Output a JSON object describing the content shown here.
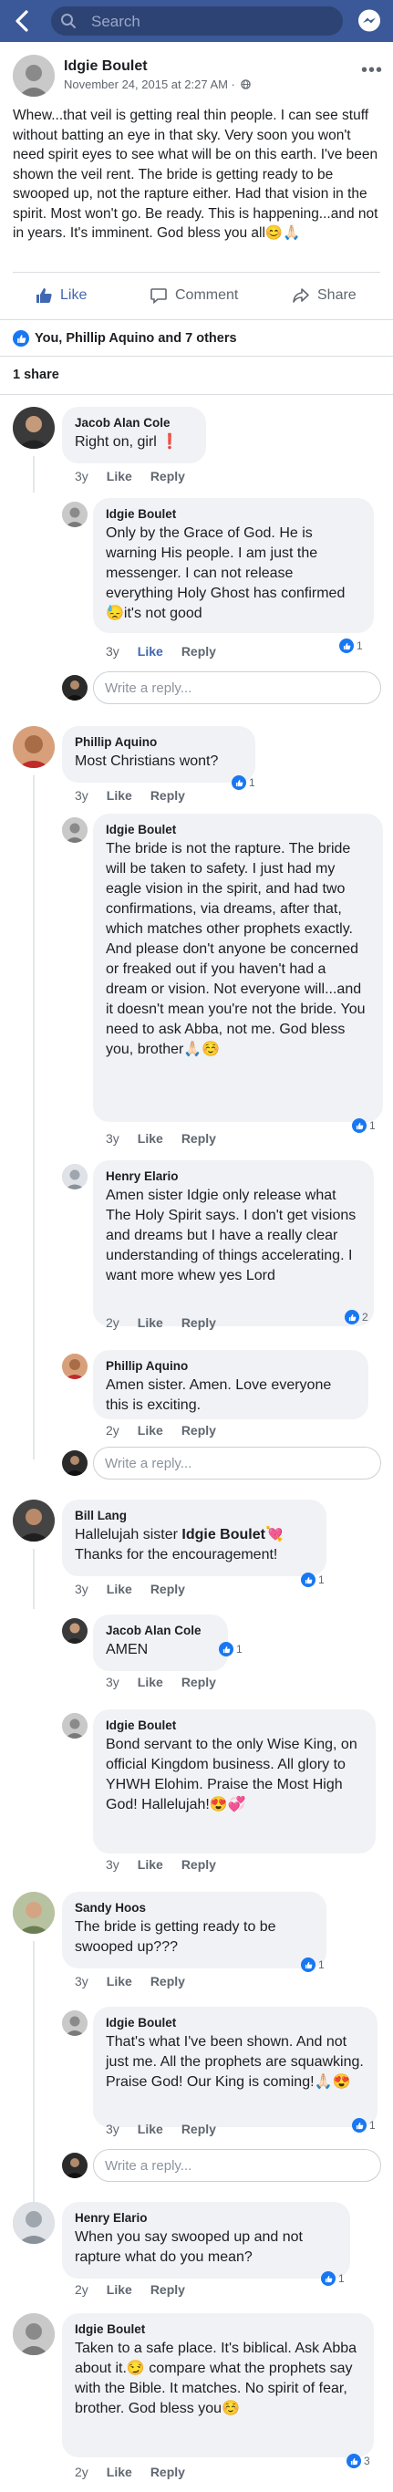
{
  "header": {
    "search_placeholder": "Search"
  },
  "post": {
    "author": "Idgie Boulet",
    "timestamp": "November 24, 2015 at 2:27 AM ·",
    "more": "•••",
    "text": "Whew...that veil is getting real thin people. I can see stuff without batting an eye in that sky. Very soon you won't need spirit eyes to see what will be on this earth. I've been shown the veil rent. The bride is getting ready to be swooped up, not the rapture either. Had that vision in the spirit. Most won't go. Be ready. This is happening...and not in years. It's imminent. God bless you all😊🙏🏻"
  },
  "actions": {
    "like": "Like",
    "comment": "Comment",
    "share": "Share"
  },
  "reactions_text": "You, Phillip Aquino and 7 others",
  "shares_text": "1 share",
  "reply_placeholder": "Write a reply...",
  "comments": [
    {
      "author": "Jacob Alan Cole",
      "text": "Right on, girl ❗",
      "time": "3y",
      "like": "Like",
      "reply": "Reply"
    },
    {
      "author": "Idgie Boulet",
      "text": "Only by the Grace of God. He is warning His people. I am just the messenger. I can not release everything Holy Ghost has confirmed😓it's not good",
      "time": "3y",
      "like": "Like",
      "reply": "Reply",
      "count": "1"
    },
    {
      "author": "Phillip Aquino",
      "text": "Most Christians wont?",
      "time": "3y",
      "like": "Like",
      "reply": "Reply",
      "count": "1"
    },
    {
      "author": "Idgie Boulet",
      "text": "The bride is not the rapture. The bride will be taken to safety. I just had my eagle vision in the spirit, and had two confirmations, via dreams, after that, which matches other prophets exactly. And please don't anyone be concerned or freaked out if you haven't had a dream or vision. Not everyone will...and it doesn't mean you're not the bride. You need to ask Abba, not me. God bless you, brother🙏🏻☺️",
      "time": "3y",
      "like": "Like",
      "reply": "Reply",
      "count": "1"
    },
    {
      "author": "Henry Elario",
      "text": "Amen sister Idgie only release what The Holy Spirit says. I don't get visions and dreams but I have a really clear understanding of things accelerating. I want more whew yes Lord",
      "time": "2y",
      "like": "Like",
      "reply": "Reply",
      "count": "2"
    },
    {
      "author": "Phillip Aquino",
      "text": "Amen sister. Amen. Love everyone this is exciting.",
      "time": "2y",
      "like": "Like",
      "reply": "Reply"
    },
    {
      "author": "Bill Lang",
      "text_pre": "Hallelujah sister ",
      "text_mention": "Idgie Boulet",
      "text_post": "💘 Thanks for the encouragement!",
      "time": "3y",
      "like": "Like",
      "reply": "Reply",
      "count": "1"
    },
    {
      "author": "Jacob Alan Cole",
      "text": "AMEN",
      "time": "3y",
      "like": "Like",
      "reply": "Reply",
      "count": "1"
    },
    {
      "author": "Idgie Boulet",
      "text": "Bond servant to the only Wise King, on official Kingdom business. All glory to YHWH Elohim. Praise the Most High God! Hallelujah!😍💞",
      "time": "3y",
      "like": "Like",
      "reply": "Reply"
    },
    {
      "author": "Sandy Hoos",
      "text": "The bride is getting ready to be swooped up???",
      "time": "3y",
      "like": "Like",
      "reply": "Reply",
      "count": "1"
    },
    {
      "author": "Idgie Boulet",
      "text": "That's what I've been shown. And not just me. All the prophets are squawking. Praise God! Our King is coming!🙏🏻😍",
      "time": "3y",
      "like": "Like",
      "reply": "Reply",
      "count": "1"
    },
    {
      "author": "Henry Elario",
      "text": "When you say swooped up and not rapture what do you mean?",
      "time": "2y",
      "like": "Like",
      "reply": "Reply",
      "count": "1"
    },
    {
      "author": "Idgie Boulet",
      "text": "Taken to a safe place. It's biblical. Ask Abba about it.😏 compare what the prophets say with the Bible. It matches. No spirit of fear, brother. God bless you☺️",
      "time": "2y",
      "like": "Like",
      "reply": "Reply",
      "count": "3"
    }
  ]
}
